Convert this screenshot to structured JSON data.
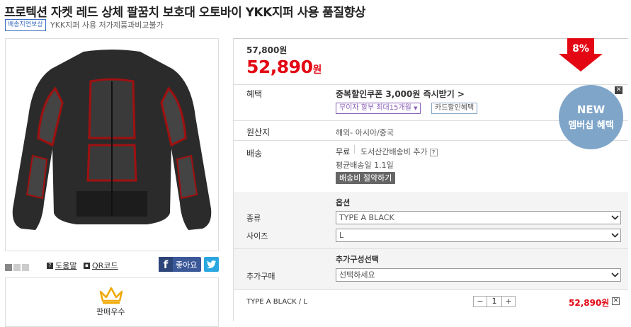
{
  "product": {
    "title_prefix": "프로텍션 자켓 레드 상체 팔꿈치 보호대 오토바이 ",
    "title_bold": "YKK",
    "title_suffix": "지퍼 사용 품질향상",
    "badge": "배송지연보상",
    "subtitle": "YKK지퍼 사용 저가제품과비교불가"
  },
  "links": {
    "help": "도움말",
    "qr": "QR코드",
    "facebook": "좋아요",
    "seller": "판매우수"
  },
  "price": {
    "original": "57,800원",
    "sale": "52,890",
    "sale_unit": "원",
    "discount": "8%"
  },
  "benefit": {
    "label": "혜택",
    "coupon": "중복할인쿠폰 3,000원 즉시받기 >",
    "installment": "무이자 할부 최대15개월",
    "card": "카드할인혜택"
  },
  "origin": {
    "label": "원산지",
    "value": "해외- 아시아/중국"
  },
  "shipping": {
    "label": "배송",
    "free": "무료",
    "extra": "도서산간배송비 추가",
    "avg": "평균배송일 1.1일",
    "save_button": "배송비 절약하기"
  },
  "options": {
    "heading": "옵션",
    "type_label": "종류",
    "type_value": "TYPE A BLACK",
    "size_label": "사이즈",
    "size_value": "L",
    "extra_heading": "추가구성선택",
    "extra_label": "추가구매",
    "extra_value": "선택하세요"
  },
  "selected": {
    "name": "TYPE A BLACK / L",
    "qty": "1",
    "price": "52,890원"
  },
  "promo": {
    "line1": "NEW",
    "line2": "멤버십 혜택"
  },
  "colors": {
    "accent": "#e30613",
    "promo_circle": "#7fa5c9"
  }
}
